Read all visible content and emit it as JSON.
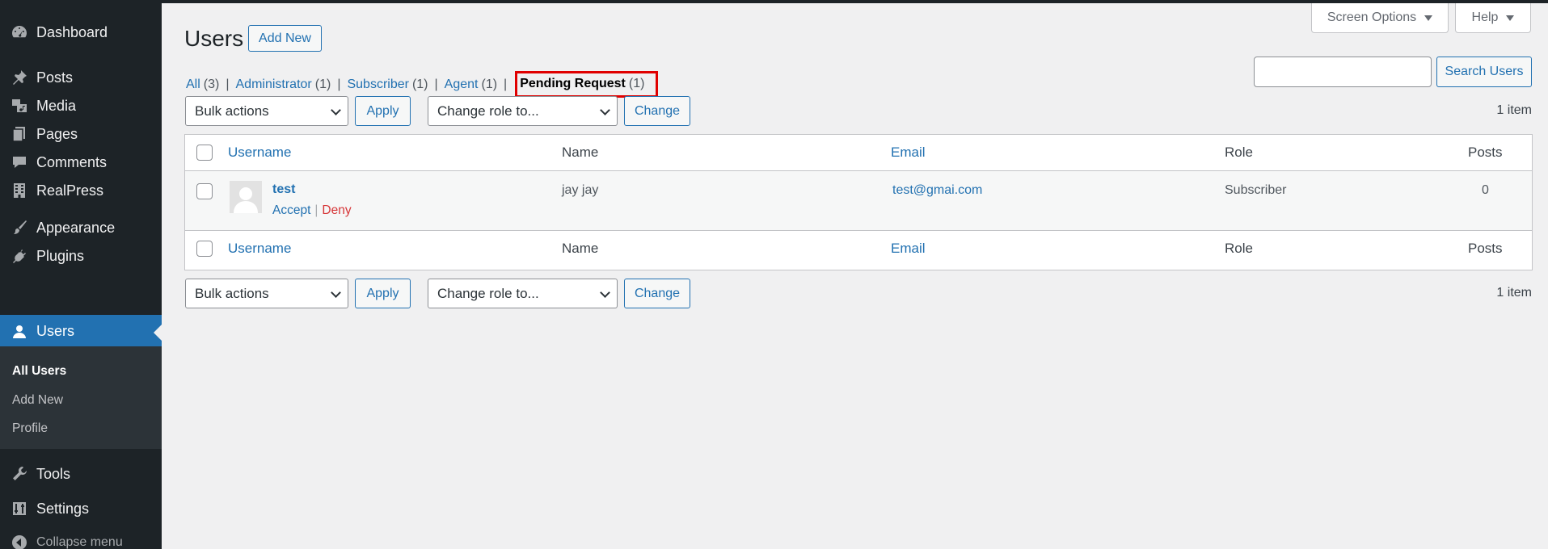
{
  "sidebar": {
    "items": [
      {
        "label": "Dashboard",
        "icon": "dashboard-icon"
      },
      {
        "label": "Posts",
        "icon": "pushpin-icon"
      },
      {
        "label": "Media",
        "icon": "media-icon"
      },
      {
        "label": "Pages",
        "icon": "pages-icon"
      },
      {
        "label": "Comments",
        "icon": "comment-icon"
      },
      {
        "label": "RealPress",
        "icon": "building-icon"
      },
      {
        "label": "Appearance",
        "icon": "paintbrush-icon"
      },
      {
        "label": "Plugins",
        "icon": "plug-icon"
      },
      {
        "label": "Users",
        "icon": "user-icon"
      },
      {
        "label": "Tools",
        "icon": "wrench-icon"
      },
      {
        "label": "Settings",
        "icon": "sliders-icon"
      }
    ],
    "current": "Users",
    "submenu": [
      "All Users",
      "Add New",
      "Profile"
    ],
    "collapse_label": "Collapse menu"
  },
  "header": {
    "screen_options": "Screen Options",
    "help": "Help",
    "title": "Users",
    "add_new": "Add New"
  },
  "views": [
    {
      "label": "All",
      "count": "(3)"
    },
    {
      "label": "Administrator",
      "count": "(1)"
    },
    {
      "label": "Subscriber",
      "count": "(1)"
    },
    {
      "label": "Agent",
      "count": "(1)"
    },
    {
      "label": "Pending Request",
      "count": "(1)",
      "current": true
    }
  ],
  "search": {
    "button": "Search Users",
    "value": ""
  },
  "tablenav": {
    "bulk_actions": "Bulk actions",
    "apply": "Apply",
    "change_role": "Change role to...",
    "change": "Change",
    "items_count": "1 item"
  },
  "table": {
    "columns": {
      "username": "Username",
      "name": "Name",
      "email": "Email",
      "role": "Role",
      "posts": "Posts"
    },
    "rows": [
      {
        "username": "test",
        "name": "jay jay",
        "email": "test@gmai.com",
        "role": "Subscriber",
        "posts": "0",
        "actions": {
          "accept": "Accept",
          "deny": "Deny",
          "sep": "|"
        }
      }
    ]
  },
  "colors": {
    "sidebar_bg": "#1d2327",
    "accent": "#2271b1",
    "highlight_box": "#e00000",
    "deny": "#d63638"
  }
}
